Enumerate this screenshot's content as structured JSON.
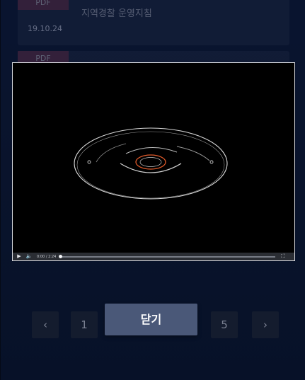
{
  "list": {
    "items": [
      {
        "badge": "PDF",
        "date": "19.10.24",
        "title": "지역경찰 운영지침"
      },
      {
        "badge": "PDF"
      }
    ]
  },
  "video": {
    "current_time": "0:00",
    "separator": "/",
    "duration": "2:24",
    "progress": 0.0,
    "icons": {
      "play": "play-icon",
      "volume": "volume-icon",
      "fullscreen": "fullscreen-icon"
    }
  },
  "pagination": {
    "prev_icon": "chevron-left-icon",
    "pages": [
      "1",
      "5"
    ],
    "next_icon": "chevron-right-icon"
  },
  "modal": {
    "close_label": "닫기"
  },
  "colors": {
    "background": "#0b1937",
    "close_button": "#4a5878",
    "pdf_badge": "#7a3250"
  }
}
